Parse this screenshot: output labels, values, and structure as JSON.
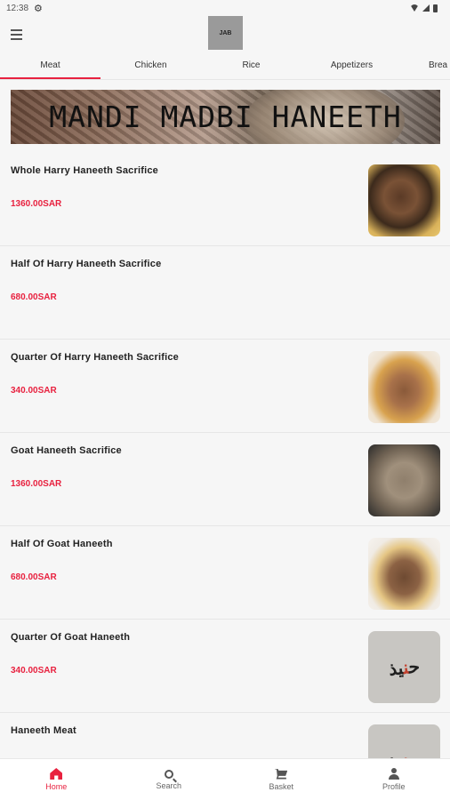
{
  "status_bar": {
    "time": "12:38"
  },
  "header": {
    "logo_text": "JAB"
  },
  "tabs": [
    {
      "label": "Meat"
    },
    {
      "label": "Chicken"
    },
    {
      "label": "Rice"
    },
    {
      "label": "Appetizers"
    },
    {
      "label": "Brea"
    }
  ],
  "banner": {
    "text": "MANDI MADBI HANEETH"
  },
  "items": [
    {
      "name": "Whole Harry Haneeth Sacrifice",
      "price": "1360.00SAR",
      "image": "meat-dish-1"
    },
    {
      "name": "Half Of Harry Haneeth Sacrifice",
      "price": "680.00SAR",
      "image": ""
    },
    {
      "name": "Quarter Of Harry Haneeth Sacrifice",
      "price": "340.00SAR",
      "image": "meat-dish-2"
    },
    {
      "name": "Goat Haneeth Sacrifice",
      "price": "1360.00SAR",
      "image": "meat-dish-3"
    },
    {
      "name": "Half Of Goat Haneeth",
      "price": "680.00SAR",
      "image": "meat-dish-4"
    },
    {
      "name": "Quarter Of Goat Haneeth",
      "price": "340.00SAR",
      "image": "restaurant-logo"
    },
    {
      "name": "Haneeth Meat",
      "price": "",
      "image": "restaurant-logo"
    }
  ],
  "bottom_nav": [
    {
      "label": "Home",
      "icon": "home-icon"
    },
    {
      "label": "Search",
      "icon": "search-icon"
    },
    {
      "label": "Basket",
      "icon": "basket-icon"
    },
    {
      "label": "Profile",
      "icon": "profile-icon"
    }
  ],
  "colors": {
    "accent": "#e8213f",
    "background": "#f6f6f6"
  }
}
